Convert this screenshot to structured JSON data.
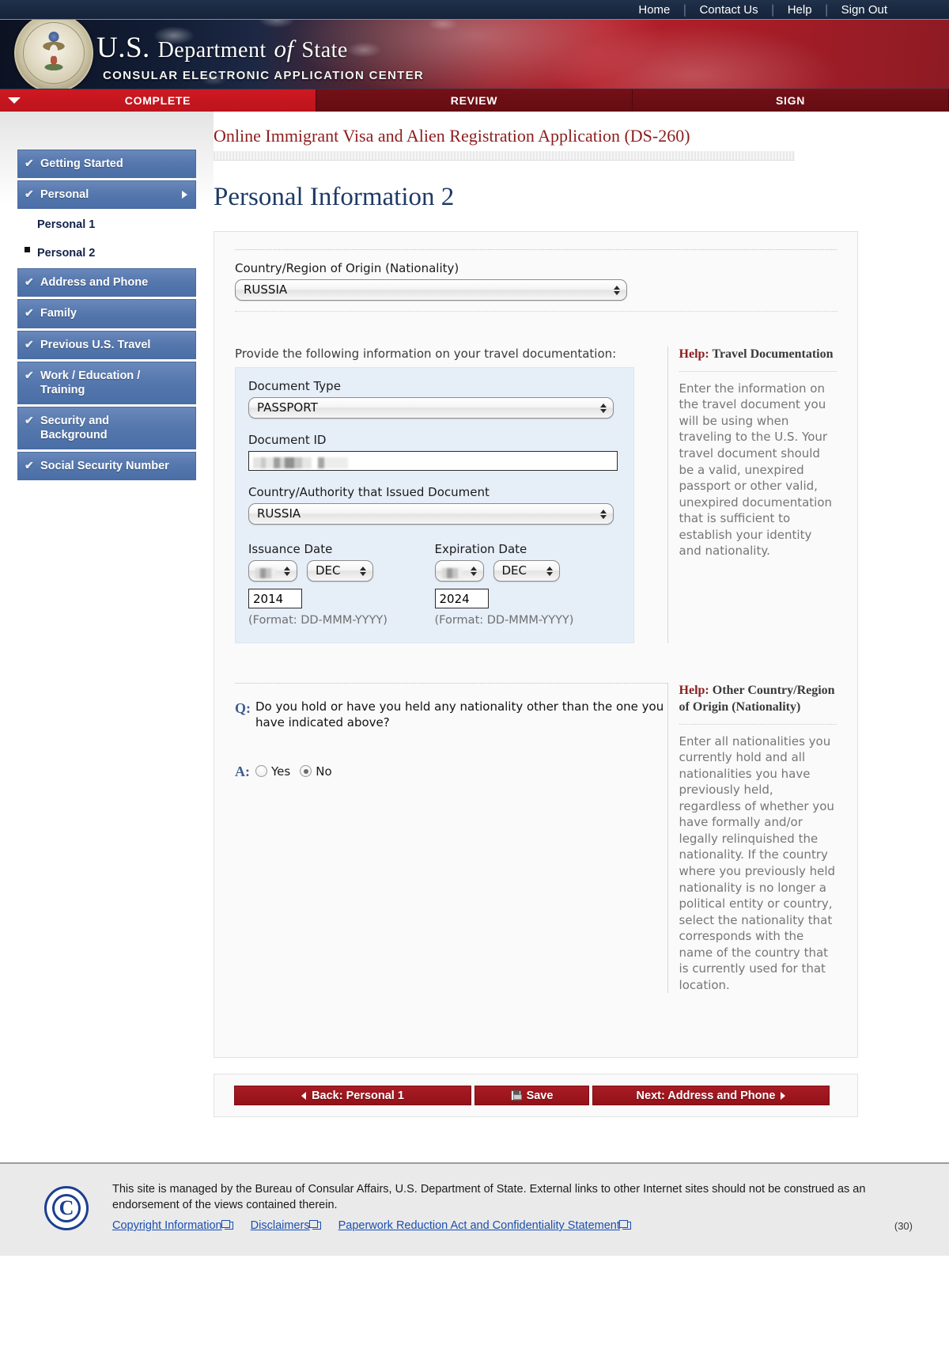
{
  "utility_nav": [
    {
      "label": "Home"
    },
    {
      "label": "Contact Us"
    },
    {
      "label": "Help"
    },
    {
      "label": "Sign Out"
    }
  ],
  "masthead": {
    "title_us": "U.S.",
    "title_department": "Department",
    "title_of": "of",
    "title_state": "State",
    "subtitle": "CONSULAR ELECTRONIC APPLICATION CENTER",
    "seal_name": "department-of-state-seal"
  },
  "steps": [
    {
      "label": "COMPLETE",
      "active": true
    },
    {
      "label": "REVIEW",
      "active": false
    },
    {
      "label": "SIGN",
      "active": false
    }
  ],
  "sidebar": {
    "items": [
      {
        "label": "Getting Started",
        "type": "section",
        "check": "✔"
      },
      {
        "label": "Personal",
        "type": "section",
        "check": "✔",
        "expanded": true
      },
      {
        "label": "Personal 1",
        "type": "sub"
      },
      {
        "label": "Personal 2",
        "type": "sub",
        "current": true
      },
      {
        "label": "Address and Phone",
        "type": "section",
        "check": "✔"
      },
      {
        "label": "Family",
        "type": "section",
        "check": "✔"
      },
      {
        "label": "Previous U.S. Travel",
        "type": "section",
        "check": "✔"
      },
      {
        "label": "Work / Education / Training",
        "type": "section",
        "check": "✔"
      },
      {
        "label": "Security and Background",
        "type": "section",
        "check": "✔"
      },
      {
        "label": "Social Security Number",
        "type": "section",
        "check": "✔"
      }
    ]
  },
  "main": {
    "app_title": "Online Immigrant Visa and Alien Registration Application (DS-260)",
    "page_title": "Personal Information 2",
    "nationality": {
      "label": "Country/Region of Origin (Nationality)",
      "value": "RUSSIA"
    },
    "travel_doc": {
      "intro": "Provide the following information on your travel documentation:",
      "document_type_label": "Document Type",
      "document_type_value": "PASSPORT",
      "document_id_label": "Document ID",
      "document_id_value": "",
      "issuing_country_label": "Country/Authority that Issued Document",
      "issuing_country_value": "RUSSIA",
      "issuance_date_label": "Issuance Date",
      "issuance_day": "",
      "issuance_month": "DEC",
      "issuance_year": "2014",
      "issuance_format": "(Format: DD-MMM-YYYY)",
      "expiration_date_label": "Expiration Date",
      "expiration_day": "",
      "expiration_month": "DEC",
      "expiration_year": "2024",
      "expiration_format": "(Format: DD-MMM-YYYY)"
    },
    "help_travel": {
      "head_word": "Help:",
      "head_topic": "Travel Documentation",
      "body": "Enter the information on the travel document you will be using when traveling to the U.S. Your travel document should be a valid, unexpired passport or other valid, unexpired documentation that is sufficient to establish your identity and nationality."
    },
    "question": {
      "q_marker": "Q:",
      "a_marker": "A:",
      "text": "Do you hold or have you held any nationality other than the one you have indicated above?",
      "options": [
        {
          "label": "Yes",
          "selected": false
        },
        {
          "label": "No",
          "selected": true
        }
      ]
    },
    "help_other": {
      "head_word": "Help:",
      "head_topic": "Other Country/Region of Origin (Nationality)",
      "body": "Enter all nationalities you currently hold and all nationalities you have previously held, regardless of whether you have formally and/or legally relinquished the nationality. If the country where you previously held nationality is no longer a political entity or country, select the nationality that corresponds with the name of the country that is currently used for that location."
    },
    "buttons": {
      "back": "Back: Personal 1",
      "save": "Save",
      "next": "Next: Address and Phone"
    }
  },
  "footer": {
    "notice": "This site is managed by the Bureau of Consular Affairs, U.S. Department of State. External links to other Internet sites should not be construed as an endorsement of the views contained therein.",
    "links": [
      {
        "label": "Copyright Information"
      },
      {
        "label": "Disclaimers"
      },
      {
        "label": "Paperwork Reduction Act and Confidentiality Statement"
      }
    ],
    "page_number": "(30)",
    "logo_glyph": "C"
  },
  "colors": {
    "brand_red": "#a81c24",
    "brand_navy": "#1e3a66",
    "nav_blue": "#5477ad",
    "help_text": "#767676",
    "link_blue": "#1a4fb0"
  }
}
